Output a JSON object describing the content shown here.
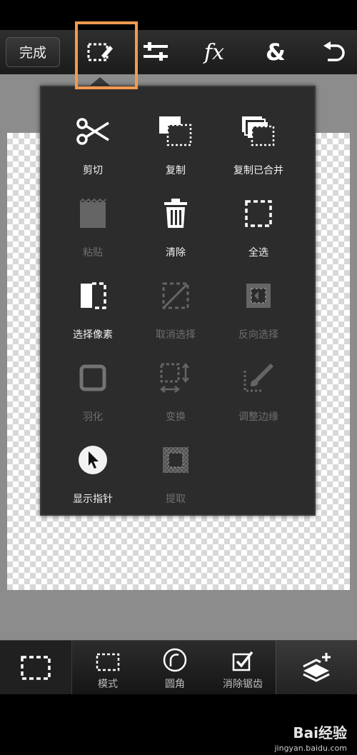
{
  "toolbar": {
    "done_label": "完成",
    "fx_label": "fx",
    "ampersand_label": "&"
  },
  "menu": {
    "items": [
      {
        "label": "剪切",
        "icon": "scissors-icon",
        "enabled": true
      },
      {
        "label": "复制",
        "icon": "copy-icon",
        "enabled": true
      },
      {
        "label": "复制已合并",
        "icon": "copy-merged-icon",
        "enabled": true
      },
      {
        "label": "粘贴",
        "icon": "paste-icon",
        "enabled": false
      },
      {
        "label": "清除",
        "icon": "trash-icon",
        "enabled": true
      },
      {
        "label": "全选",
        "icon": "select-all-icon",
        "enabled": true
      },
      {
        "label": "选择像素",
        "icon": "select-pixels-icon",
        "enabled": true
      },
      {
        "label": "取消选择",
        "icon": "deselect-icon",
        "enabled": false
      },
      {
        "label": "反向选择",
        "icon": "invert-selection-icon",
        "enabled": false
      },
      {
        "label": "羽化",
        "icon": "feather-icon",
        "enabled": false
      },
      {
        "label": "变换",
        "icon": "transform-icon",
        "enabled": false
      },
      {
        "label": "调整边缘",
        "icon": "refine-edge-icon",
        "enabled": false
      },
      {
        "label": "显示指针",
        "icon": "show-pointer-icon",
        "enabled": true
      },
      {
        "label": "提取",
        "icon": "extract-icon",
        "enabled": false
      }
    ]
  },
  "bottom": {
    "mode_label": "模式",
    "rounded_label": "圆角",
    "antialias_label": "消除锯齿"
  },
  "watermark": {
    "main": "Bai经验",
    "sub": "jingyan.baidu.com"
  },
  "colors": {
    "highlight": "#f39a4f",
    "popup_bg": "#2c2c2c"
  }
}
